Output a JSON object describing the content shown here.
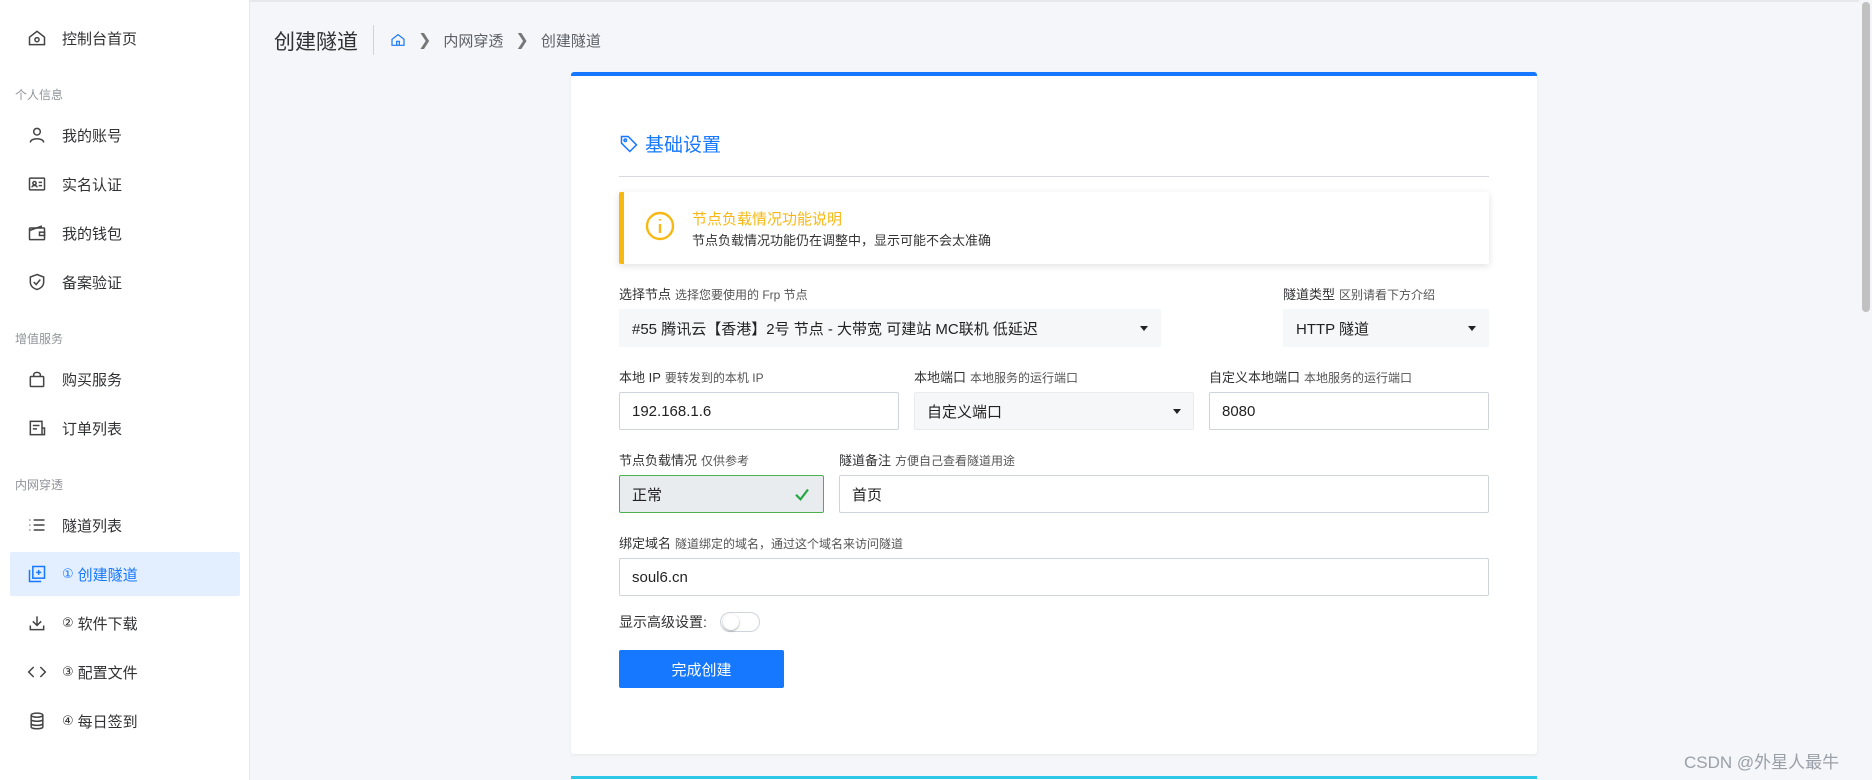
{
  "sidebar": {
    "items": [
      {
        "label": "控制台首页",
        "icon": "home-icon"
      },
      {
        "label": "我的账号",
        "icon": "user-icon"
      },
      {
        "label": "实名认证",
        "icon": "id-card-icon"
      },
      {
        "label": "我的钱包",
        "icon": "wallet-icon"
      },
      {
        "label": "备案验证",
        "icon": "shield-check-icon"
      },
      {
        "label": "购买服务",
        "icon": "shopping-bag-icon"
      },
      {
        "label": "订单列表",
        "icon": "order-list-icon"
      },
      {
        "label": "隧道列表",
        "icon": "list-icon"
      },
      {
        "num": "①",
        "label": "创建隧道",
        "icon": "add-copy-icon",
        "active": true
      },
      {
        "num": "②",
        "label": "软件下载",
        "icon": "download-icon"
      },
      {
        "num": "③",
        "label": "配置文件",
        "icon": "code-icon"
      },
      {
        "num": "④",
        "label": "每日签到",
        "icon": "database-icon"
      }
    ],
    "groups": [
      "个人信息",
      "增值服务",
      "内网穿透"
    ]
  },
  "header": {
    "title": "创建隧道",
    "breadcrumb": [
      "内网穿透",
      "创建隧道"
    ]
  },
  "section": {
    "title": "基础设置"
  },
  "alert": {
    "title": "节点负载情况功能说明",
    "text": "节点负载情况功能仍在调整中，显示可能不会太准确"
  },
  "form": {
    "node": {
      "label": "选择节点",
      "hint": "选择您要使用的 Frp 节点",
      "value": "#55 腾讯云【香港】2号 节点 - 大带宽 可建站 MC联机 低延迟"
    },
    "tunnel_type": {
      "label": "隧道类型",
      "hint": "区别请看下方介绍",
      "value": "HTTP 隧道"
    },
    "local_ip": {
      "label": "本地 IP",
      "hint": "要转发到的本机 IP",
      "value": "192.168.1.6"
    },
    "local_port": {
      "label": "本地端口",
      "hint": "本地服务的运行端口",
      "value": "自定义端口"
    },
    "custom_port": {
      "label": "自定义本地端口",
      "hint": "本地服务的运行端口",
      "value": "8080"
    },
    "load": {
      "label": "节点负载情况",
      "hint": "仅供参考",
      "value": "正常"
    },
    "remark": {
      "label": "隧道备注",
      "hint": "方便自己查看隧道用途",
      "value": "首页"
    },
    "domain": {
      "label": "绑定域名",
      "hint": "隧道绑定的域名，通过这个域名来访问隧道",
      "value": "soul6.cn"
    },
    "advanced_label": "显示高级设置:",
    "advanced_on": false,
    "submit_label": "完成创建"
  },
  "watermark": "CSDN @外星人最牛",
  "colors": {
    "primary": "#1677ff",
    "warning": "#f7b815",
    "success": "#28a745"
  }
}
